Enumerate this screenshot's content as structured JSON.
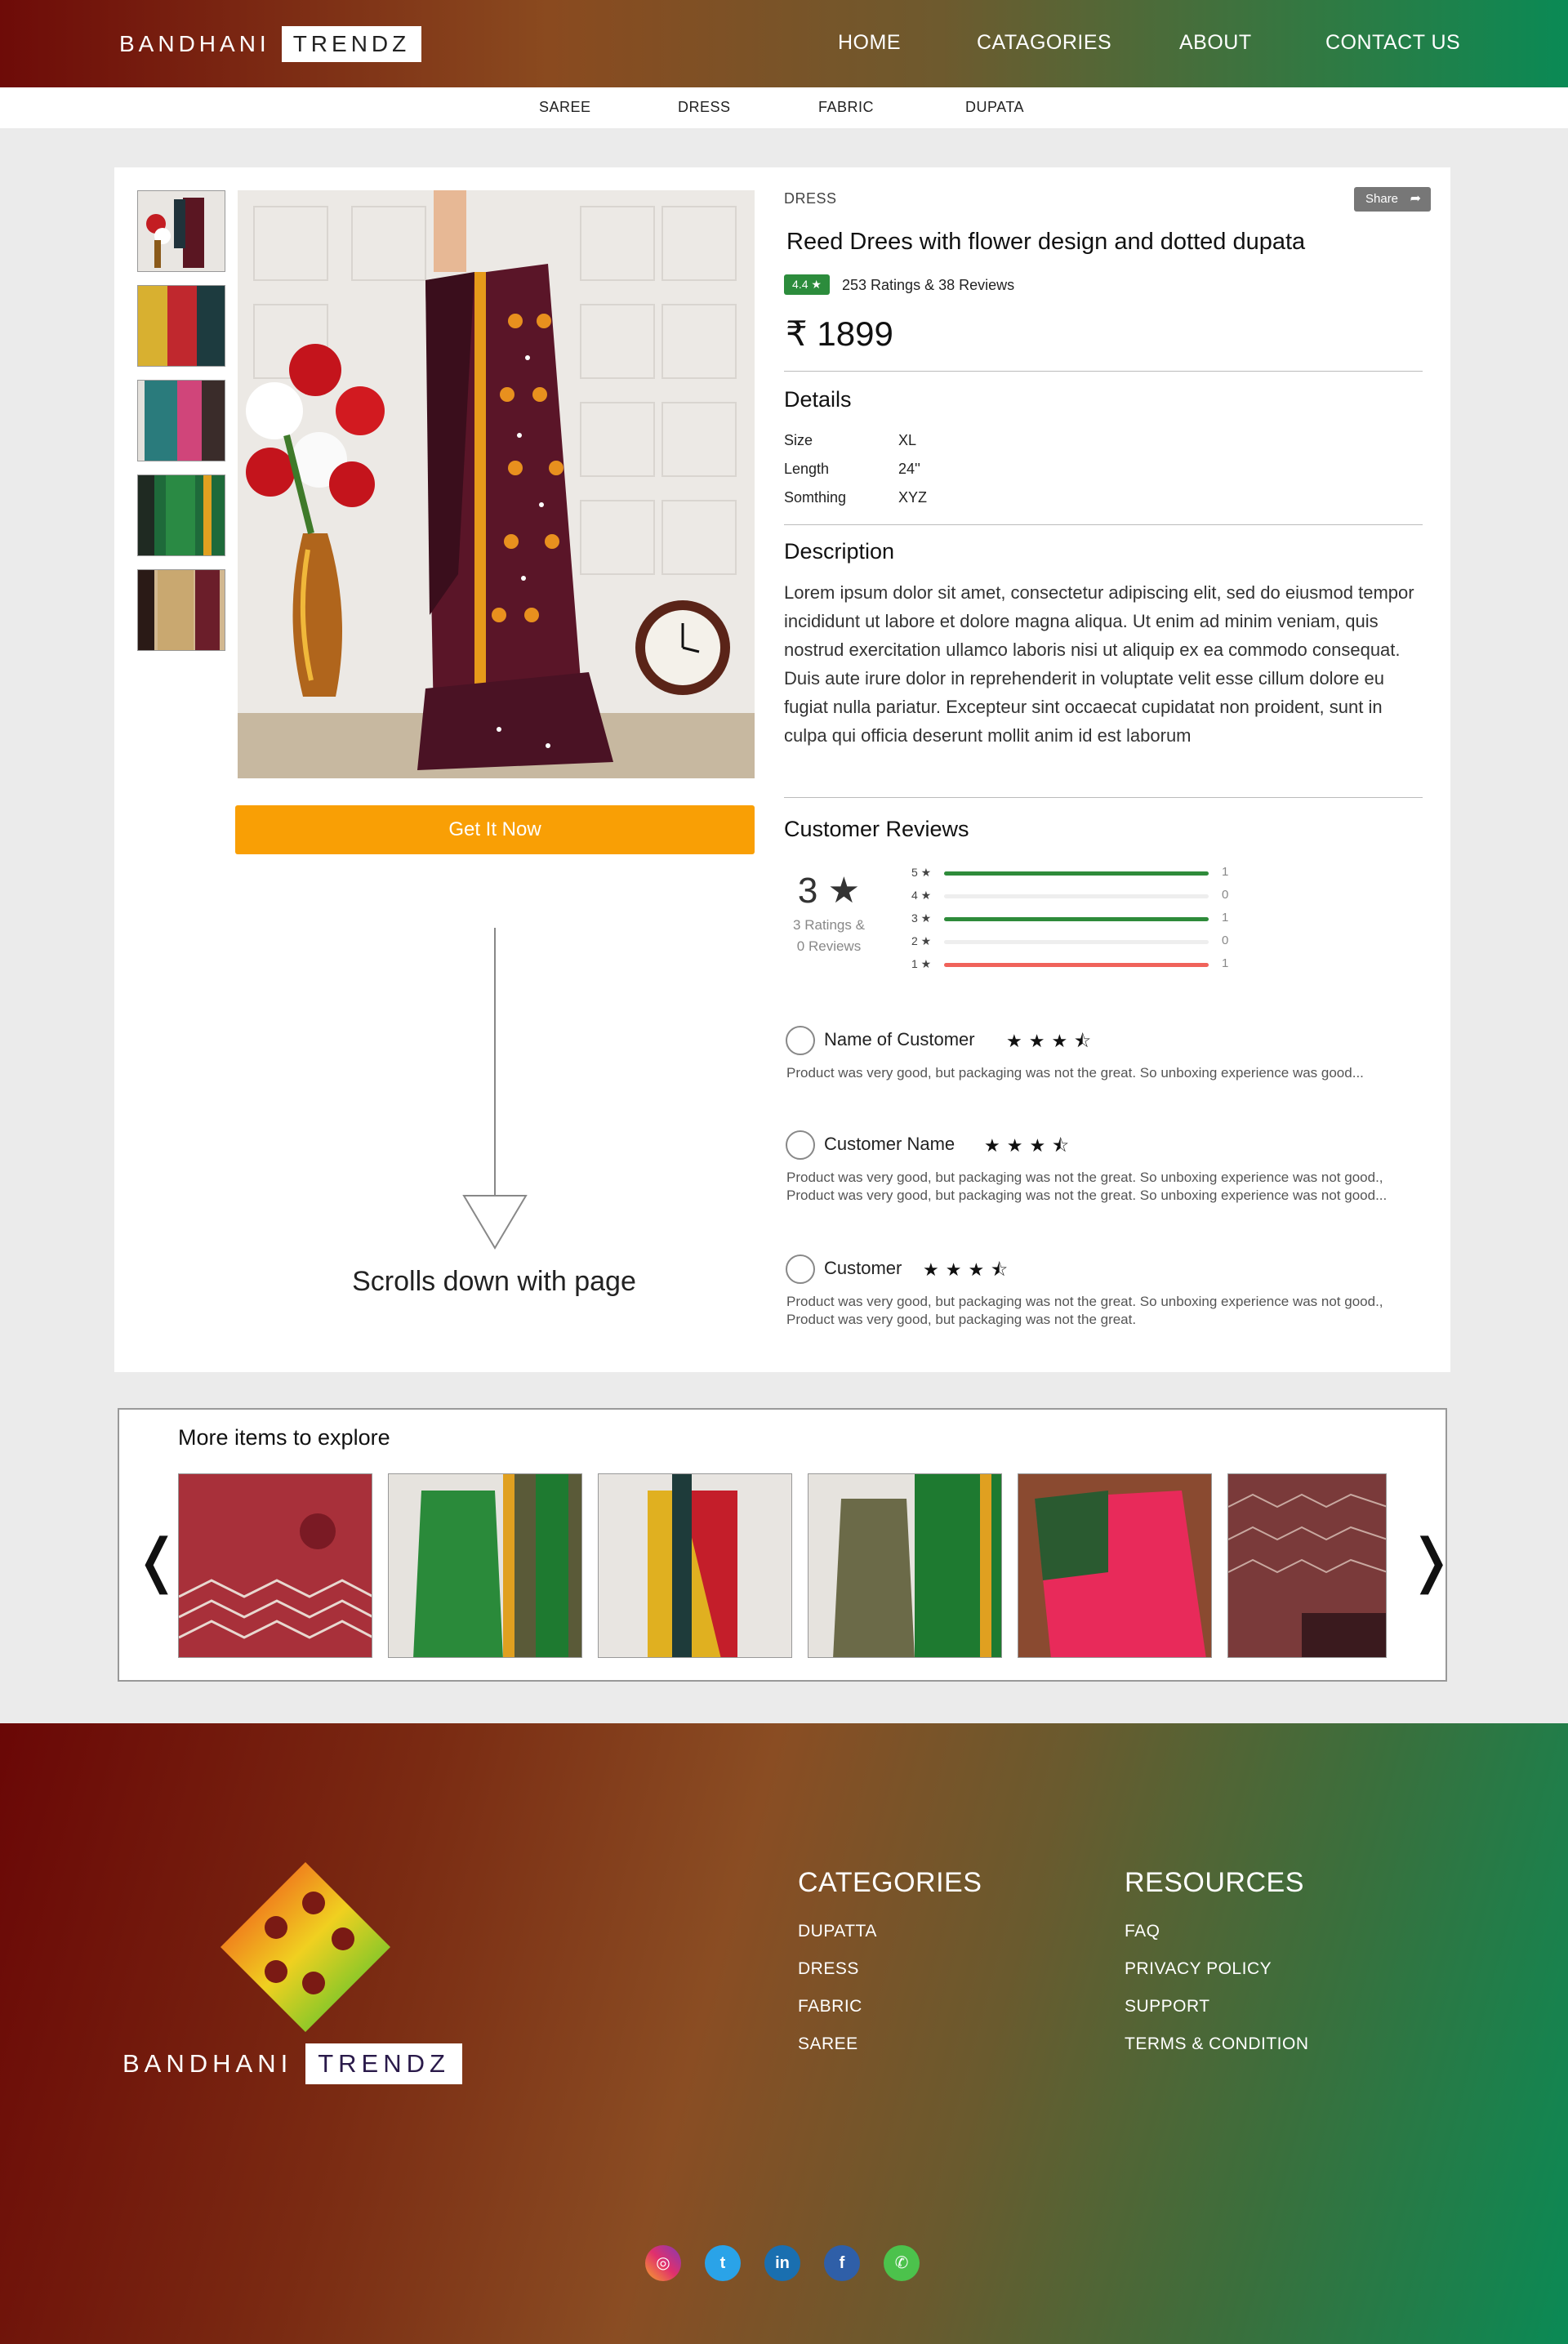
{
  "brand": {
    "word1": "BANDHANI",
    "word2": "TRENDZ"
  },
  "nav": {
    "home": "HOME",
    "categories": "CATAGORIES",
    "about": "ABOUT",
    "contact": "CONTACT US"
  },
  "subnav": {
    "saree": "SAREE",
    "dress": "DRESS",
    "fabric": "FABRIC",
    "dupata": "DUPATA"
  },
  "product": {
    "category": "DRESS",
    "share": "Share",
    "title": "Reed Drees with flower design and dotted dupata",
    "rating": "4.4 ★",
    "ratings_text": "253 Ratings & 38 Reviews",
    "price": "₹ 1899",
    "cta": "Get It Now"
  },
  "scroll_note": "Scrolls down with page",
  "details": {
    "heading": "Details",
    "rows": [
      {
        "key": "Size",
        "value": "XL"
      },
      {
        "key": "Length",
        "value": "24''"
      },
      {
        "key": "Somthing",
        "value": "XYZ"
      }
    ]
  },
  "description": {
    "heading": "Description",
    "text": "Lorem ipsum dolor sit amet, consectetur adipiscing elit, sed do eiusmod tempor incididunt ut labore et dolore magna aliqua. Ut enim ad minim veniam, quis nostrud exercitation ullamco laboris nisi ut aliquip ex ea commodo consequat. Duis aute irure dolor in reprehenderit in voluptate velit esse cillum dolore eu fugiat nulla pariatur. Excepteur sint occaecat cupidatat non proident, sunt in culpa qui officia deserunt mollit anim id est laborum"
  },
  "reviews": {
    "heading": "Customer Reviews",
    "average": "3 ★",
    "average_sub_1": "3 Ratings &",
    "average_sub_2": "0 Reviews",
    "breakdown": [
      {
        "label": "5 ★",
        "count": "1",
        "fraction": 1.0,
        "color": "#2e8b3a"
      },
      {
        "label": "4 ★",
        "count": "0",
        "fraction": 0,
        "color": "#2e8b3a"
      },
      {
        "label": "3 ★",
        "count": "1",
        "fraction": 1.0,
        "color": "#2e8b3a"
      },
      {
        "label": "2 ★",
        "count": "0",
        "fraction": 0,
        "color": "#2e8b3a"
      },
      {
        "label": "1 ★",
        "count": "1",
        "fraction": 1.0,
        "color": "#f0625a"
      }
    ],
    "items": [
      {
        "name": "Name of Customer",
        "stars": "★★★⯪",
        "text": "Product was very good, but packaging was not the great. So unboxing experience was good..."
      },
      {
        "name": "Customer Name",
        "stars": "★★★⯪",
        "text": "Product was very good, but packaging was not the great. So unboxing experience was not good., Product was very good, but packaging was not the great. So unboxing experience was not good..."
      },
      {
        "name": "Customer",
        "stars": "★★★⯪",
        "text": "Product was very good, but packaging was not the great. So unboxing experience was not good., Product was very good, but packaging was not the great."
      }
    ]
  },
  "more": {
    "heading": "More items to explore",
    "prev": "❬",
    "next": "❭"
  },
  "footer": {
    "categories_heading": "CATEGORIES",
    "categories": [
      "DUPATTA",
      "DRESS",
      "FABRIC",
      "SAREE"
    ],
    "resources_heading": "RESOURCES",
    "resources": [
      "FAQ",
      "PRIVACY POLICY",
      "SUPPORT",
      "TERMS & CONDITION"
    ],
    "brand_word1": "BANDHANI",
    "brand_word2": "TRENDZ"
  },
  "social": {
    "instagram": "◎",
    "twitter": "t",
    "linkedin": "in",
    "facebook": "f",
    "whatsapp": "✆"
  },
  "colors": {
    "accent": "#f99f05",
    "rating_green": "#2c8c3c",
    "bar_red": "#f0625a"
  },
  "icons": [
    "share-icon",
    "star-icon",
    "chevron-left-icon",
    "chevron-right-icon",
    "down-arrow-icon",
    "instagram-icon",
    "twitter-icon",
    "linkedin-icon",
    "facebook-icon",
    "whatsapp-icon",
    "brand-logo-icon"
  ]
}
